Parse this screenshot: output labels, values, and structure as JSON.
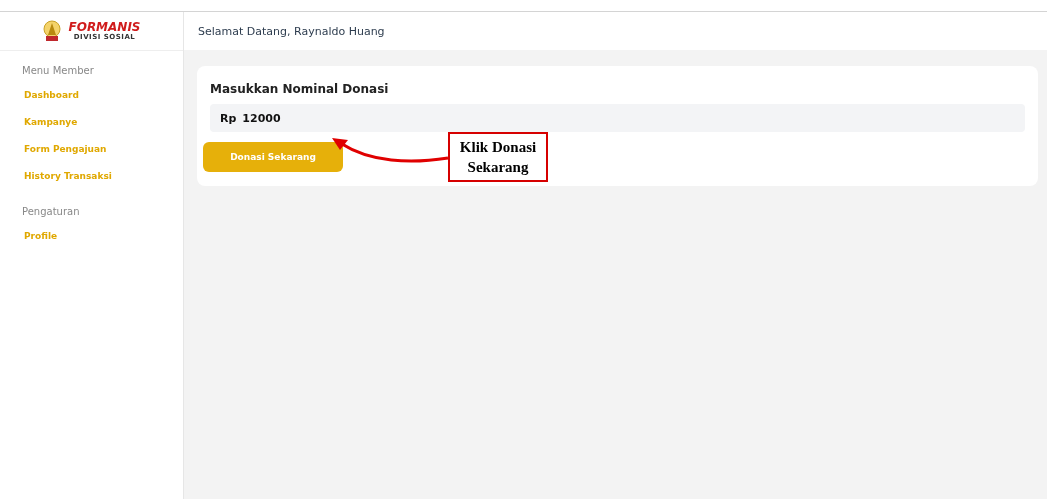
{
  "logo": {
    "name": "FORMANIS",
    "subtitle": "DIVISI SOSIAL"
  },
  "header": {
    "greeting": "Selamat Datang, Raynaldo Huang"
  },
  "sidebar": {
    "sections": [
      {
        "heading": "Menu Member",
        "items": [
          {
            "label": "Dashboard"
          },
          {
            "label": "Kampanye"
          },
          {
            "label": "Form Pengajuan"
          },
          {
            "label": "History Transaksi"
          }
        ]
      },
      {
        "heading": "Pengaturan",
        "items": [
          {
            "label": "Profile"
          }
        ]
      }
    ]
  },
  "donation": {
    "title": "Masukkan Nominal Donasi",
    "currency": "Rp",
    "value": "12000",
    "button": "Donasi Sekarang"
  },
  "annotation": {
    "lines": [
      "Klik Donasi",
      "Sekarang"
    ]
  }
}
